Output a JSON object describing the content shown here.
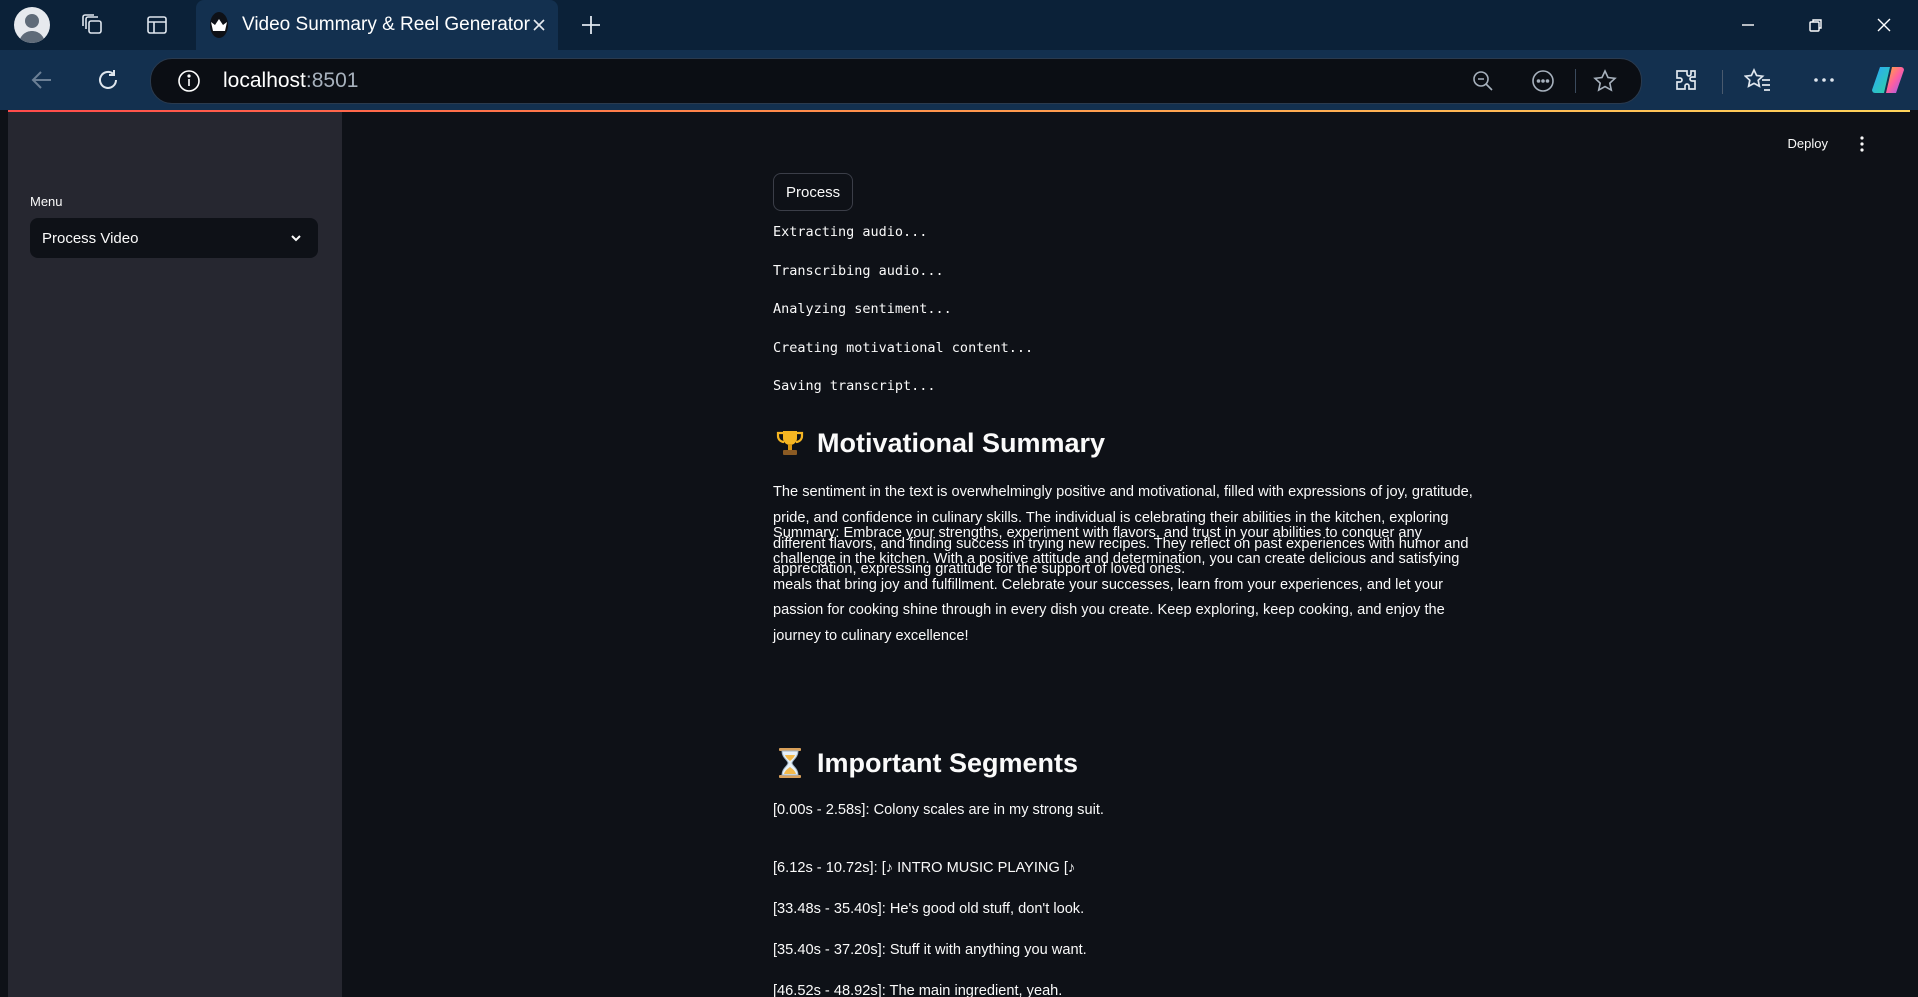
{
  "browser": {
    "tab_title": "Video Summary & Reel Generator",
    "url_host": "localhost",
    "url_port": ":8501"
  },
  "header": {
    "deploy_label": "Deploy"
  },
  "sidebar": {
    "menu_label": "Menu",
    "menu_selected": "Process Video"
  },
  "main": {
    "process_button": "Process",
    "status_lines": [
      "Extracting audio...",
      "Transcribing audio...",
      "Analyzing sentiment...",
      "Creating motivational content...",
      "Saving transcript..."
    ],
    "summary_heading": "Motivational Summary",
    "sentiment_text": "The sentiment in the text is overwhelmingly positive and motivational, filled with expressions of joy, gratitude, pride, and confidence in culinary skills. The individual is celebrating their abilities in the kitchen, exploring different flavors, and finding success in trying new recipes. They reflect on past experiences with humor and appreciation, expressing gratitude for the support of loved ones.",
    "summary_text": "Summary: Embrace your strengths, experiment with flavors, and trust in your abilities to conquer any challenge in the kitchen. With a positive attitude and determination, you can create delicious and satisfying meals that bring joy and fulfillment. Celebrate your successes, learn from your experiences, and let your passion for cooking shine through in every dish you create. Keep exploring, keep cooking, and enjoy the journey to culinary excellence!",
    "segments_heading": "Important Segments",
    "segments": [
      "[0.00s - 2.58s]: Colony scales are in my strong suit.",
      "[6.12s - 10.72s]: [♪ INTRO MUSIC PLAYING [♪",
      "[33.48s - 35.40s]: He's good old stuff, don't look.",
      "[35.40s - 37.20s]: Stuff it with anything you want.",
      "[46.52s - 48.92s]: The main ingredient, yeah."
    ]
  },
  "icons": {
    "summary_emoji": "trophy-icon",
    "segments_emoji": "hourglass-icon"
  },
  "colors": {
    "app_bg": "#0e1117",
    "sidebar_bg": "#262730",
    "tabbar_bg": "#0b2138",
    "toolbar_bg": "#13304f",
    "accent": "#ff4b4b"
  }
}
